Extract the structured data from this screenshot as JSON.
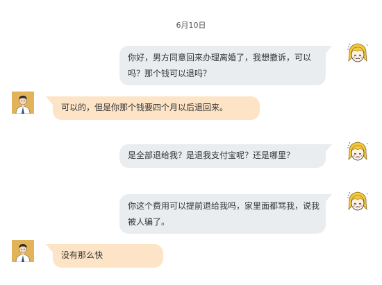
{
  "chat": {
    "date_label": "6月10日",
    "avatars": {
      "customer_icon": "blonde-girl-avatar-icon",
      "agent_icon": "man-in-suit-avatar-icon",
      "agent_bg_color": "#e2b457",
      "incoming_bubble_color": "#fde4c6",
      "outgoing_bubble_color": "#e9edf0"
    },
    "messages": [
      {
        "sender": "customer",
        "text": "你好，男方同意回来办理离婚了，我想撤诉，可以吗？那个钱可以退吗？"
      },
      {
        "sender": "agent",
        "text": "可以的，但是你那个钱要四个月以后退回来。"
      },
      {
        "sender": "customer",
        "text": "是全部退给我？是退我支付宝呢？还是哪里？"
      },
      {
        "sender": "customer",
        "text": "你这个费用可以提前退给我吗，家里面都骂我，说我被人骗了。"
      },
      {
        "sender": "agent",
        "text": "没有那么快"
      }
    ]
  }
}
